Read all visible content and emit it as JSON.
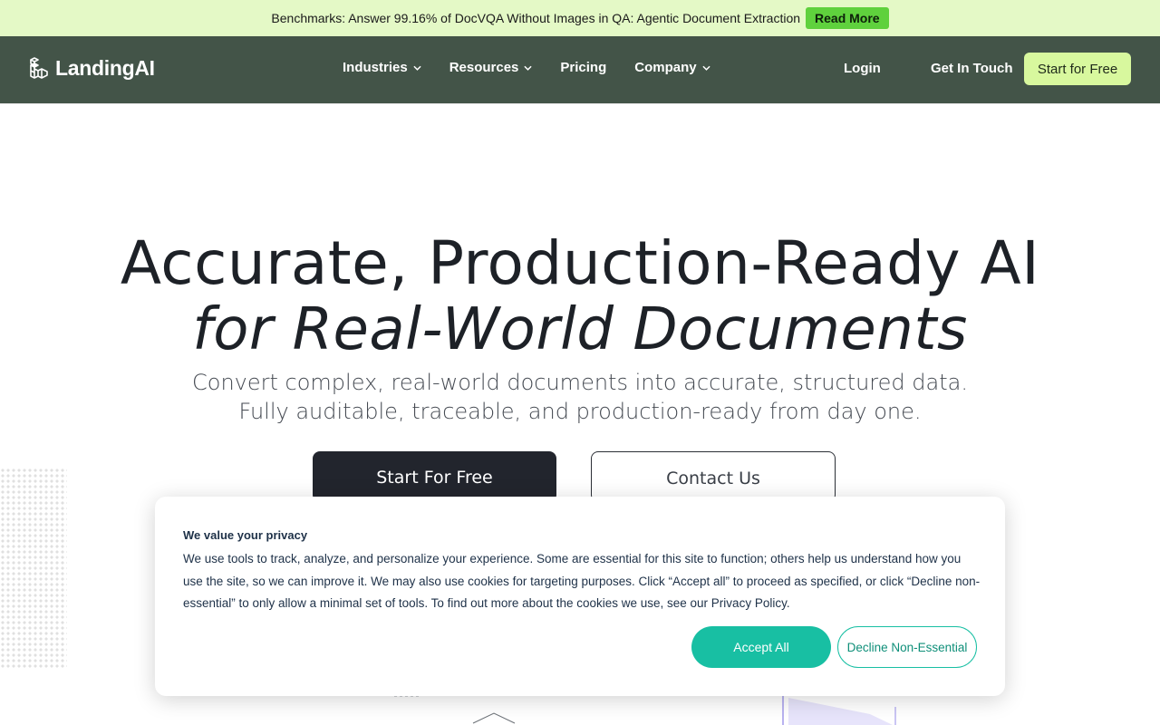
{
  "announcement": {
    "text": "Benchmarks: Answer 99.16% of DocVQA Without Images in QA: Agentic Document Extraction",
    "button": "Read More"
  },
  "nav": {
    "brand": "LandingAI",
    "links": [
      {
        "label": "Industries",
        "has_dropdown": true
      },
      {
        "label": "Resources",
        "has_dropdown": true
      },
      {
        "label": "Pricing",
        "has_dropdown": false
      },
      {
        "label": "Company",
        "has_dropdown": true
      }
    ],
    "login": "Login",
    "contact": "Get In Touch",
    "cta": "Start for Free"
  },
  "hero": {
    "title": "Accurate, Production-Ready AI",
    "title_italic": "for Real-World Documents",
    "subtitle": "Convert complex, real-world documents into accurate, structured data. Fully auditable, traceable, and production-ready from day one.",
    "primary_button": "Start For Free",
    "secondary_button": "Contact Us"
  },
  "cookie_banner": {
    "title": "We value your privacy",
    "body": "We use tools to track, analyze, and personalize your experience. Some are essential for this site to function; others help us understand how you use the site, so we can improve it. We may also use cookies for targeting purposes. Click “Accept all” to proceed as specified, or click “Decline non-essential” to only allow a minimal set of tools. To find out more about the cookies we use, see our Privacy Policy.",
    "accept": "Accept All",
    "decline": "Decline Non-Essential"
  },
  "colors": {
    "nav_bg": "#435448",
    "announce_bg": "#e4f9c6",
    "read_more_bg": "#5fd13d",
    "cta_bg": "#d8f89e",
    "accent_teal": "#18bfa3",
    "primary_button_bg": "#22252d"
  }
}
